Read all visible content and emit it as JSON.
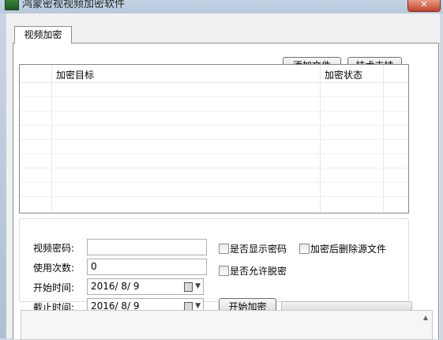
{
  "window": {
    "title": "鸿蒙密视视频加密软件",
    "close_glyph": "✕"
  },
  "tabs": [
    {
      "label": "视频加密"
    }
  ],
  "toolbar": {
    "add_file": "添加文件",
    "tech_support": "技术支持"
  },
  "list": {
    "columns": [
      "加密目标",
      "加密状态"
    ],
    "rows": []
  },
  "form": {
    "password_label": "视频密码:",
    "password_value": "",
    "usage_count_label": "使用次数:",
    "usage_count_value": "0",
    "start_time_label": "开始时间:",
    "start_time_value": "2016/ 8/ 9",
    "end_time_label": "截止时间:",
    "end_time_value": "2016/ 8/ 9",
    "show_password_label": "是否显示密码",
    "show_password_checked": false,
    "delete_source_label": "加密后删除源文件",
    "delete_source_checked": false,
    "allow_decrypt_label": "是否允许脱密",
    "allow_decrypt_checked": false,
    "start_button": "开始加密",
    "progress": 0
  },
  "icons": {
    "app": "app-icon",
    "calendar": "calendar-icon",
    "dropdown": "chevron-down-icon",
    "scroll_up": "scroll-up-icon"
  }
}
